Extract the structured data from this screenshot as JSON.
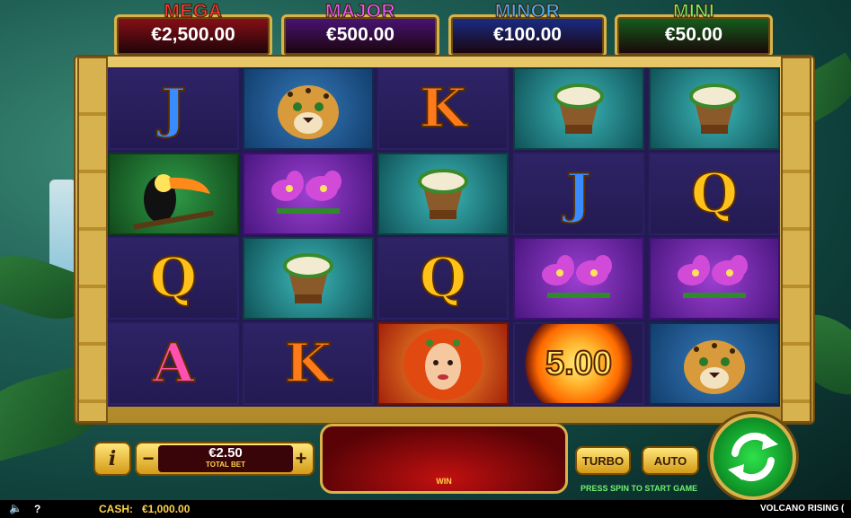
{
  "jackpots": [
    {
      "label": "MEGA",
      "value": "€2,500.00",
      "label_color": "#ff3b3b",
      "panel_color": "#8b0f17"
    },
    {
      "label": "MAJOR",
      "value": "€500.00",
      "label_color": "#e35cff",
      "panel_color": "#4a1478"
    },
    {
      "label": "MINOR",
      "value": "€100.00",
      "label_color": "#4ab3ff",
      "panel_color": "#1a2d8a"
    },
    {
      "label": "MINI",
      "value": "€50.00",
      "label_color": "#6ff26f",
      "panel_color": "#15601e"
    }
  ],
  "reels": {
    "orb_value": "5.00",
    "symbols": [
      [
        "J",
        "jaguar",
        "K",
        "drum",
        "drum"
      ],
      [
        "toucan",
        "orchid",
        "drum",
        "J",
        "Q"
      ],
      [
        "Q",
        "drum",
        "Q",
        "orchid",
        "orchid"
      ],
      [
        "A",
        "K",
        "goddess",
        "fire-orb",
        "jaguar"
      ]
    ]
  },
  "controls": {
    "info_label": "i",
    "minus_label": "−",
    "plus_label": "+",
    "bet_value": "€2.50",
    "bet_caption": "TOTAL BET",
    "win_caption": "WIN",
    "turbo_label": "TURBO",
    "auto_label": "AUTO",
    "hint": "PRESS SPIN TO START GAME"
  },
  "footer": {
    "help_label": "?",
    "cash_label": "CASH:",
    "cash_value": "€1,000.00",
    "game_title": "VOLCANO RISING ("
  },
  "colors": {
    "accent_gold": "#d9b24a",
    "spin_green": "#1fbf3a"
  }
}
